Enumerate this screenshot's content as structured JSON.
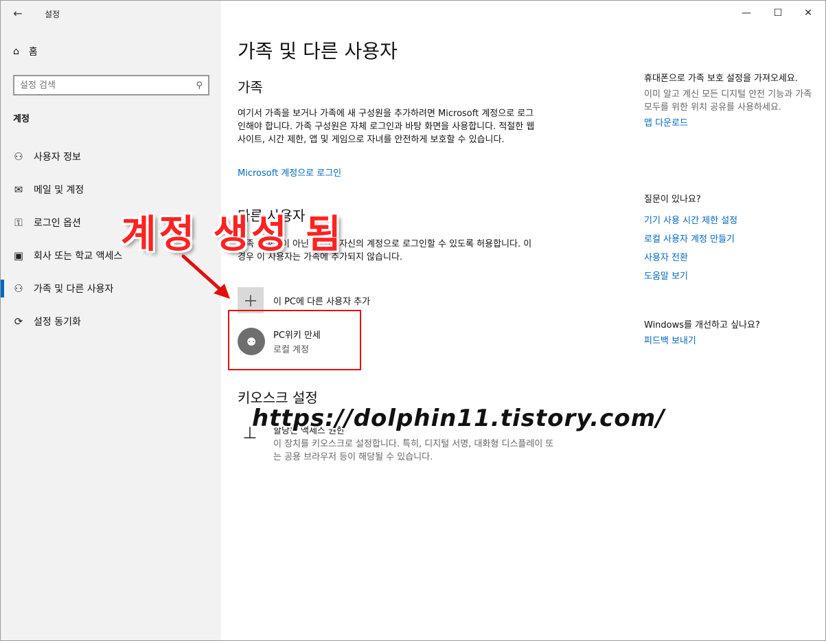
{
  "window": {
    "app_title": "설정",
    "back_icon": "←",
    "controls": {
      "minimize": "—",
      "maximize": "☐",
      "close": "✕"
    }
  },
  "sidebar": {
    "home_label": "홈",
    "search_placeholder": "설정 검색",
    "section_label": "계정",
    "items": [
      {
        "label": "사용자 정보",
        "icon": "user-info-icon",
        "glyph": "⚇"
      },
      {
        "label": "메일 및 계정",
        "icon": "mail-icon",
        "glyph": "✉"
      },
      {
        "label": "로그인 옵션",
        "icon": "key-icon",
        "glyph": "⚿"
      },
      {
        "label": "회사 또는 학교 액세스",
        "icon": "briefcase-icon",
        "glyph": "▣"
      },
      {
        "label": "가족 및 다른 사용자",
        "icon": "family-icon",
        "glyph": "⚇"
      },
      {
        "label": "설정 동기화",
        "icon": "sync-icon",
        "glyph": "⟳"
      }
    ]
  },
  "main": {
    "page_title": "가족 및 다른 사용자",
    "family": {
      "heading": "가족",
      "description": "여기서 가족을 보거나 가족에 새 구성원을 추가하려면 Microsoft 계정으로 로그인해야 합니다. 가족 구성원은 자체 로그인과 바탕 화면을 사용합니다. 적절한 웹 사이트, 시간 제한, 앱 및 게임으로 자녀를 안전하게 보호할 수 있습니다.",
      "signin_link": "Microsoft 계정으로 로그인"
    },
    "other_users": {
      "heading": "다른 사용자",
      "description": "가족 구성원이 아닌 사람이 자신의 계정으로 로그인할 수 있도록 허용합니다. 이 경우 이 사용자는 가족에 추가되지 않습니다.",
      "add_label": "이 PC에 다른 사용자 추가",
      "user": {
        "name": "PC위키 만세",
        "type": "로컬 계정"
      }
    },
    "kiosk": {
      "heading": "키오스크 설정",
      "title": "할당된 액세스 권한",
      "description": "이 장치를 키오스크로 설정합니다. 특히, 디지털 서명, 대화형 디스플레이 또는 공용 브라우저 등이 해당될 수 있습니다."
    }
  },
  "right": {
    "phone_heading": "휴대폰으로 가족 보호 설정을 가져오세요.",
    "phone_text": "이미 알고 계신 모든 디지털 안전 기능과 가족 모두를 위한 위치 공유를 사용하세요.",
    "app_download": "앱 다운로드",
    "question_heading": "질문이 있나요?",
    "links": [
      "기기 사용 시간 제한 설정",
      "로컬 사용자 계정 만들기",
      "사용자 전환",
      "도움말 보기"
    ],
    "improve_heading": "Windows를 개선하고 싶나요?",
    "feedback_link": "피드백 보내기"
  },
  "overlay": {
    "caption": "계정 생성 됨",
    "url": "https://dolphin11.tistory.com/",
    "highlight_color": "#e01010"
  }
}
